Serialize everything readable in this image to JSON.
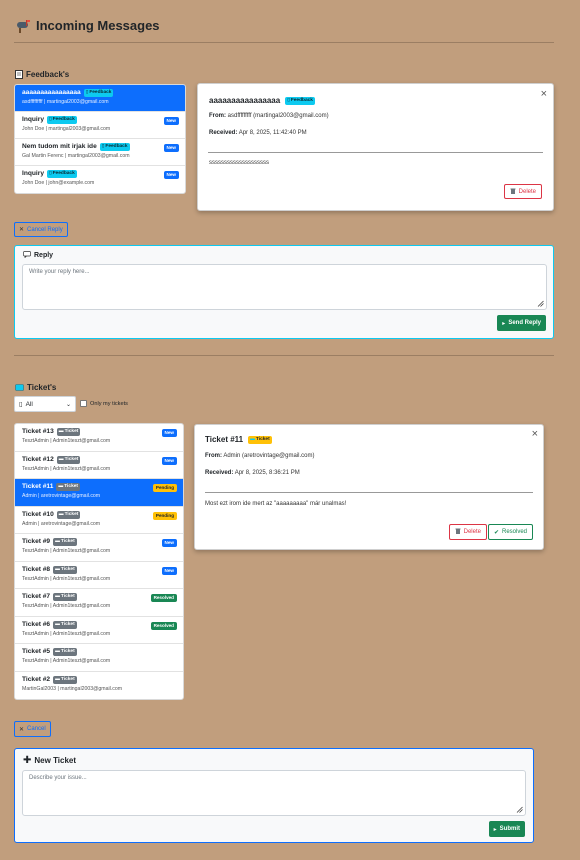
{
  "header": {
    "title": "Incoming Messages",
    "icon": "mailbox-icon"
  },
  "feedback": {
    "section_title": "Feedback's",
    "items": [
      {
        "title": "aaaaaaaaaaaaaaaa",
        "tag": "Feedback",
        "sub": "asdfffffffff | martingal2003@gmail.com",
        "status": "",
        "active": true
      },
      {
        "title": "Inquiry",
        "tag": "Feedback",
        "sub": "John Doe | martingal2003@gmail.com",
        "status": "New",
        "active": false
      },
      {
        "title": "Nem tudom mit irjak ide",
        "tag": "Feedback",
        "sub": "Gal Martin Ferenc | martingal2003@gmail.com",
        "status": "New",
        "active": false
      },
      {
        "title": "Inquiry",
        "tag": "Feedback",
        "sub": "John Doe | john@example.com",
        "status": "New",
        "active": false
      }
    ],
    "detail": {
      "title": "aaaaaaaaaaaaaaaa",
      "tag": "Feedback",
      "from_label": "From:",
      "from_value": "asdfffffffff (martingal2003@gmail.com)",
      "received_label": "Received:",
      "received_value": "Apr 8, 2025, 11:42:40 PM",
      "body": "ssssssssssssssssssss",
      "delete_label": "Delete"
    },
    "cancel_reply_label": "Cancel Reply",
    "reply": {
      "title": "Reply",
      "placeholder": "Write your reply here...",
      "send_label": "Send Reply"
    }
  },
  "tickets": {
    "section_title": "Ticket's",
    "filter_value": "All",
    "only_mine_label": "Only my tickets",
    "items": [
      {
        "title": "Ticket #13",
        "tag": "Ticket",
        "sub": "TesztAdmin | Admin1teszt@gmail.com",
        "status": "New",
        "status_type": "new",
        "active": false
      },
      {
        "title": "Ticket #12",
        "tag": "Ticket",
        "sub": "TesztAdmin | Admin1teszt@gmail.com",
        "status": "New",
        "status_type": "new",
        "active": false
      },
      {
        "title": "Ticket #11",
        "tag": "Ticket",
        "sub": "Admin | aretrovintage@gmail.com",
        "status": "Pending",
        "status_type": "pending",
        "active": true
      },
      {
        "title": "Ticket #10",
        "tag": "Ticket",
        "sub": "Admin | aretrovintage@gmail.com",
        "status": "Pending",
        "status_type": "pending",
        "active": false
      },
      {
        "title": "Ticket #9",
        "tag": "Ticket",
        "sub": "TesztAdmin | Admin1teszt@gmail.com",
        "status": "New",
        "status_type": "new",
        "active": false
      },
      {
        "title": "Ticket #8",
        "tag": "Ticket",
        "sub": "TesztAdmin | Admin1teszt@gmail.com",
        "status": "New",
        "status_type": "new",
        "active": false
      },
      {
        "title": "Ticket #7",
        "tag": "Ticket",
        "sub": "TesztAdmin | Admin1teszt@gmail.com",
        "status": "Resolved",
        "status_type": "resolved",
        "active": false
      },
      {
        "title": "Ticket #6",
        "tag": "Ticket",
        "sub": "TesztAdmin | Admin1teszt@gmail.com",
        "status": "Resolved",
        "status_type": "resolved",
        "active": false
      },
      {
        "title": "Ticket #5",
        "tag": "Ticket",
        "sub": "TesztAdmin | Admin1teszt@gmail.com",
        "status": "",
        "status_type": "",
        "active": false
      },
      {
        "title": "Ticket #2",
        "tag": "Ticket",
        "sub": "MartinGal2003 | martingal2003@gmail.com",
        "status": "",
        "status_type": "",
        "active": false
      }
    ],
    "detail": {
      "title": "Ticket #11",
      "tag": "Ticket",
      "from_label": "From:",
      "from_value": "Admin (aretrovintage@gmail.com)",
      "received_label": "Received:",
      "received_value": "Apr 8, 2025, 8:36:21 PM",
      "body": "Most ezt irom ide mert az \"aaaaaaaaa\" már unalmas!",
      "delete_label": "Delete",
      "resolved_label": "Resolved"
    },
    "cancel_label": "Cancel",
    "new_ticket": {
      "title": "New Ticket",
      "placeholder": "Describe your issue...",
      "submit_label": "Submit"
    }
  },
  "colors": {
    "background": "#c19e7d",
    "primary": "#0d6efd",
    "info": "#0dcaf0",
    "success": "#198754",
    "danger": "#dc3545",
    "warning": "#ffc107"
  }
}
